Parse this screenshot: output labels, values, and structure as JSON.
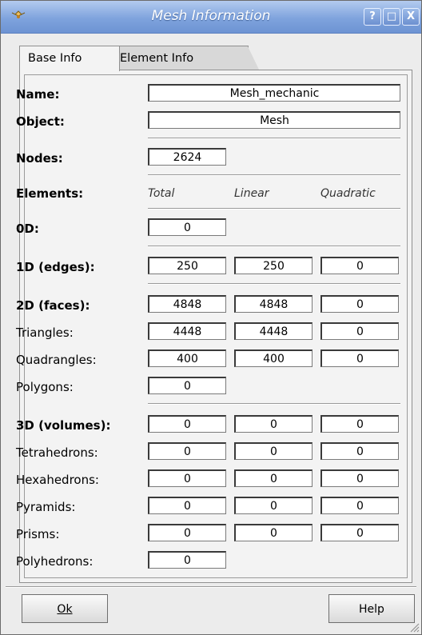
{
  "window": {
    "title": "Mesh Information",
    "help_glyph": "?",
    "maximize_glyph": "□",
    "close_glyph": "X"
  },
  "tabs": [
    {
      "label": "Base Info",
      "active": true
    },
    {
      "label": "Element Info",
      "active": false
    }
  ],
  "info": {
    "name_label": "Name:",
    "name_value": "Mesh_mechanic",
    "object_label": "Object:",
    "object_value": "Mesh",
    "nodes_label": "Nodes:",
    "nodes_value": "2624"
  },
  "elements": {
    "label": "Elements:",
    "columns": [
      "Total",
      "Linear",
      "Quadratic"
    ],
    "rows": [
      {
        "label": "0D:",
        "bold": true,
        "values": [
          "0"
        ]
      },
      {
        "label": "1D (edges):",
        "bold": true,
        "values": [
          "250",
          "250",
          "0"
        ]
      },
      {
        "label": "2D (faces):",
        "bold": true,
        "values": [
          "4848",
          "4848",
          "0"
        ]
      },
      {
        "label": "Triangles:",
        "bold": false,
        "values": [
          "4448",
          "4448",
          "0"
        ]
      },
      {
        "label": "Quadrangles:",
        "bold": false,
        "values": [
          "400",
          "400",
          "0"
        ]
      },
      {
        "label": "Polygons:",
        "bold": false,
        "values": [
          "0"
        ]
      },
      {
        "label": "3D (volumes):",
        "bold": true,
        "values": [
          "0",
          "0",
          "0"
        ]
      },
      {
        "label": "Tetrahedrons:",
        "bold": false,
        "values": [
          "0",
          "0",
          "0"
        ]
      },
      {
        "label": "Hexahedrons:",
        "bold": false,
        "values": [
          "0",
          "0",
          "0"
        ]
      },
      {
        "label": "Pyramids:",
        "bold": false,
        "values": [
          "0",
          "0",
          "0"
        ]
      },
      {
        "label": "Prisms:",
        "bold": false,
        "values": [
          "0",
          "0",
          "0"
        ]
      },
      {
        "label": "Polyhedrons:",
        "bold": false,
        "values": [
          "0"
        ]
      }
    ]
  },
  "buttons": {
    "ok": "Ok",
    "help": "Help"
  },
  "colors": {
    "titlebar": "#7fa3dd",
    "window_bg": "#ececec"
  }
}
